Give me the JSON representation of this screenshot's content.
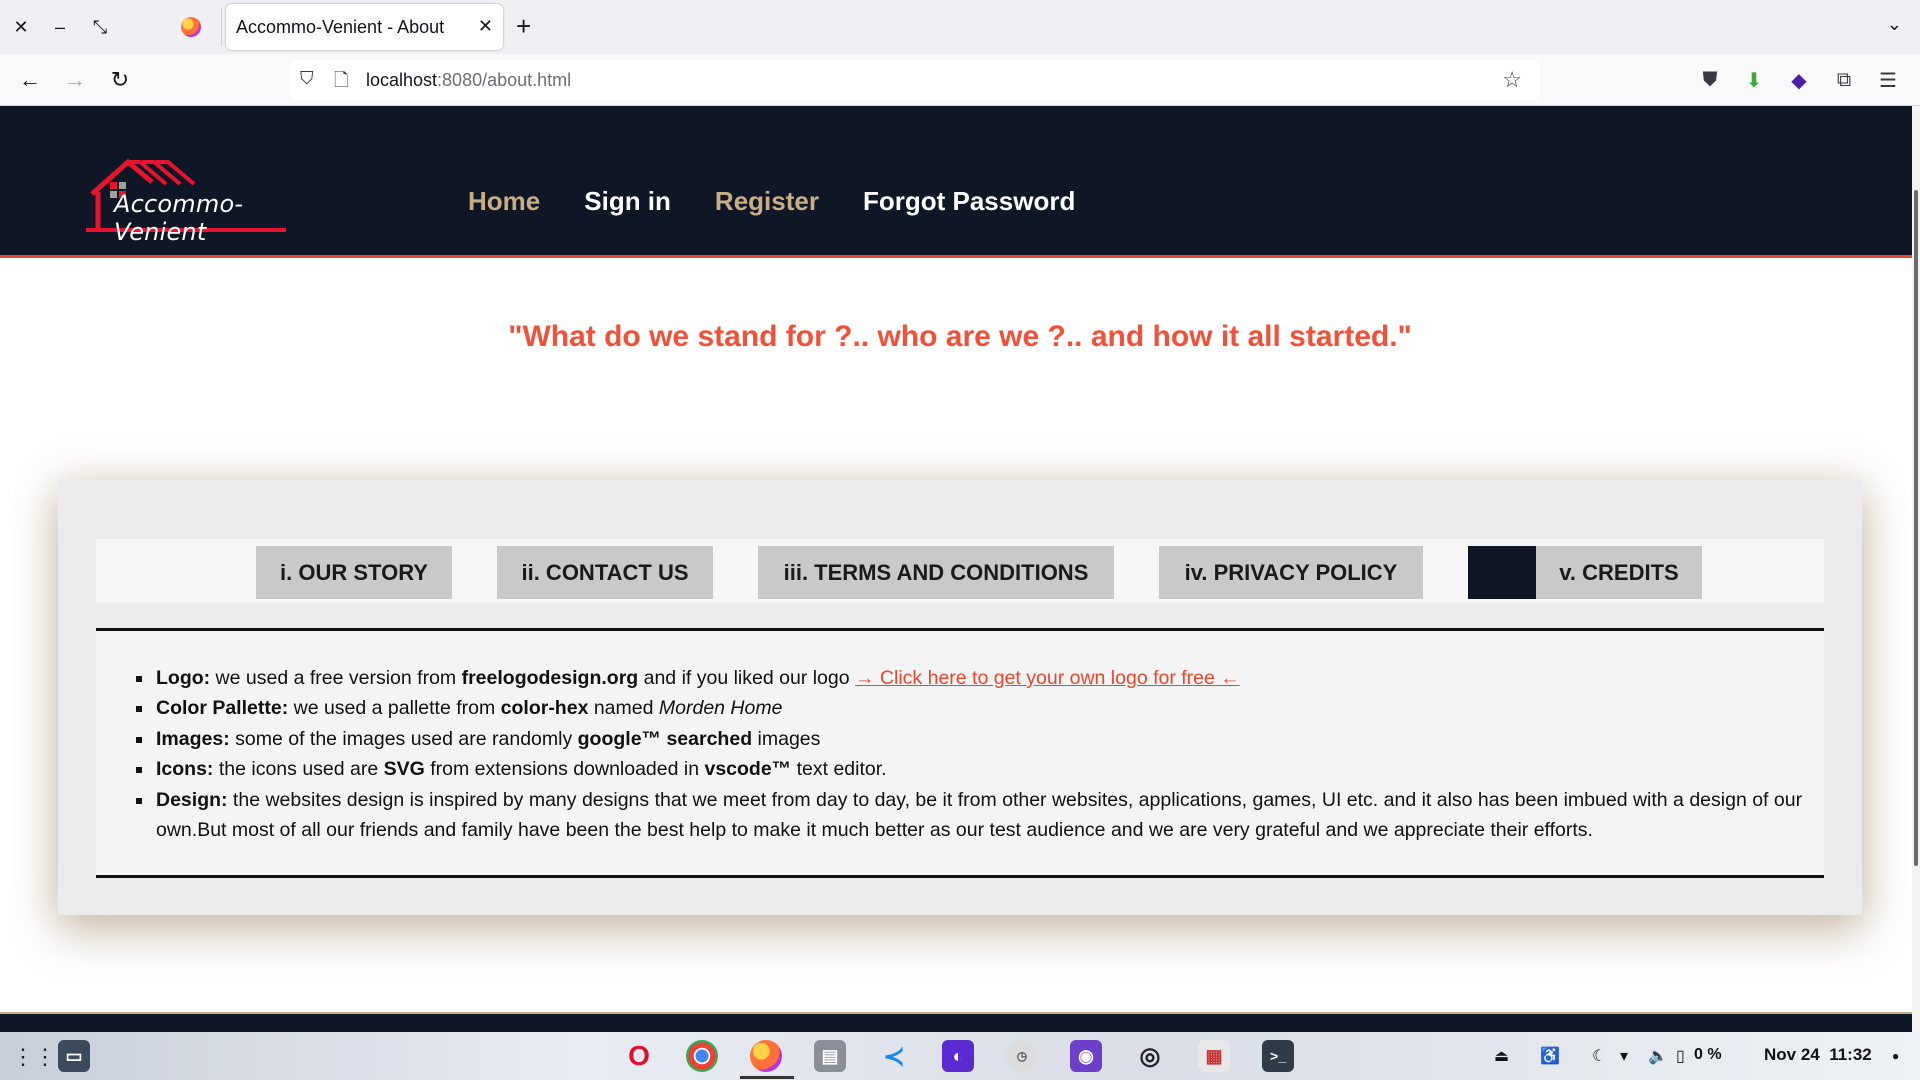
{
  "browser": {
    "tab_title": "Accommo-Venient - About",
    "url_host": "localhost",
    "url_rest": ":8080/about.html"
  },
  "site": {
    "logo_text": "Accommo-Venient",
    "nav": [
      "Home",
      "Sign in",
      "Register",
      "Forgot Password"
    ],
    "tagline": "\"What do we stand for ?.. who are we ?.. and how it all started.\"",
    "tabs": [
      "i. OUR STORY",
      "ii. CONTACT US",
      "iii. TERMS AND CONDITIONS",
      "iv. PRIVACY POLICY",
      "v. CREDITS"
    ],
    "credits": {
      "logo_label": "Logo:",
      "logo_text1": " we used a free version from ",
      "logo_bold": "freelogodesign.org",
      "logo_text2": " and if you liked our logo ",
      "logo_link": "→ Click here to get your own logo for free ←",
      "color_label": "Color Pallette:",
      "color_text1": " we used a pallette from ",
      "color_bold": "color-hex",
      "color_text2": " named ",
      "color_italic": "Morden Home",
      "images_label": "Images:",
      "images_text1": " some of the images used are randomly ",
      "images_bold": "google™ searched",
      "images_text2": " images",
      "icons_label": "Icons:",
      "icons_text1": " the icons used are ",
      "icons_bold1": "SVG",
      "icons_text2": " from extensions downloaded in ",
      "icons_bold2": "vscode™",
      "icons_text3": " text editor.",
      "design_label": "Design:",
      "design_text": " the websites design is inspired by many designs that we meet from day to day, be it from other websites, applications, games, UI etc. and it also has been imbued with a design of our own.But most of all our friends and family have been the best help to make it much better as our test audience and we are very grateful and we appreciate their efforts."
    }
  },
  "taskbar": {
    "battery": "0 %",
    "date": "Nov 24",
    "time": "11:32"
  },
  "colors": {
    "header_bg": "#0f1626",
    "accent_red": "#e8472e",
    "gold": "#c8ad85",
    "tagline": "#f05138"
  }
}
